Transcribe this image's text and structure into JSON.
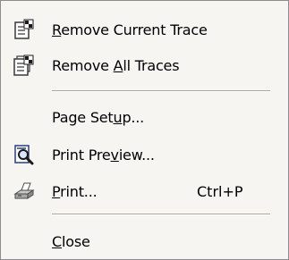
{
  "menu": {
    "items": [
      {
        "pre": "",
        "ul": "R",
        "post": "emove Current Trace",
        "icon": "remove-trace-icon"
      },
      {
        "pre": "Remove ",
        "ul": "A",
        "post": "ll Traces",
        "icon": "remove-all-traces-icon"
      },
      {
        "pre": "Page Set",
        "ul": "u",
        "post": "p...",
        "icon": ""
      },
      {
        "pre": "Print Pre",
        "ul": "v",
        "post": "iew...",
        "icon": "print-preview-icon"
      },
      {
        "pre": "",
        "ul": "P",
        "post": "rint...",
        "icon": "printer-icon",
        "shortcut": "Ctrl+P"
      },
      {
        "pre": "",
        "ul": "C",
        "post": "lose",
        "icon": ""
      }
    ]
  }
}
